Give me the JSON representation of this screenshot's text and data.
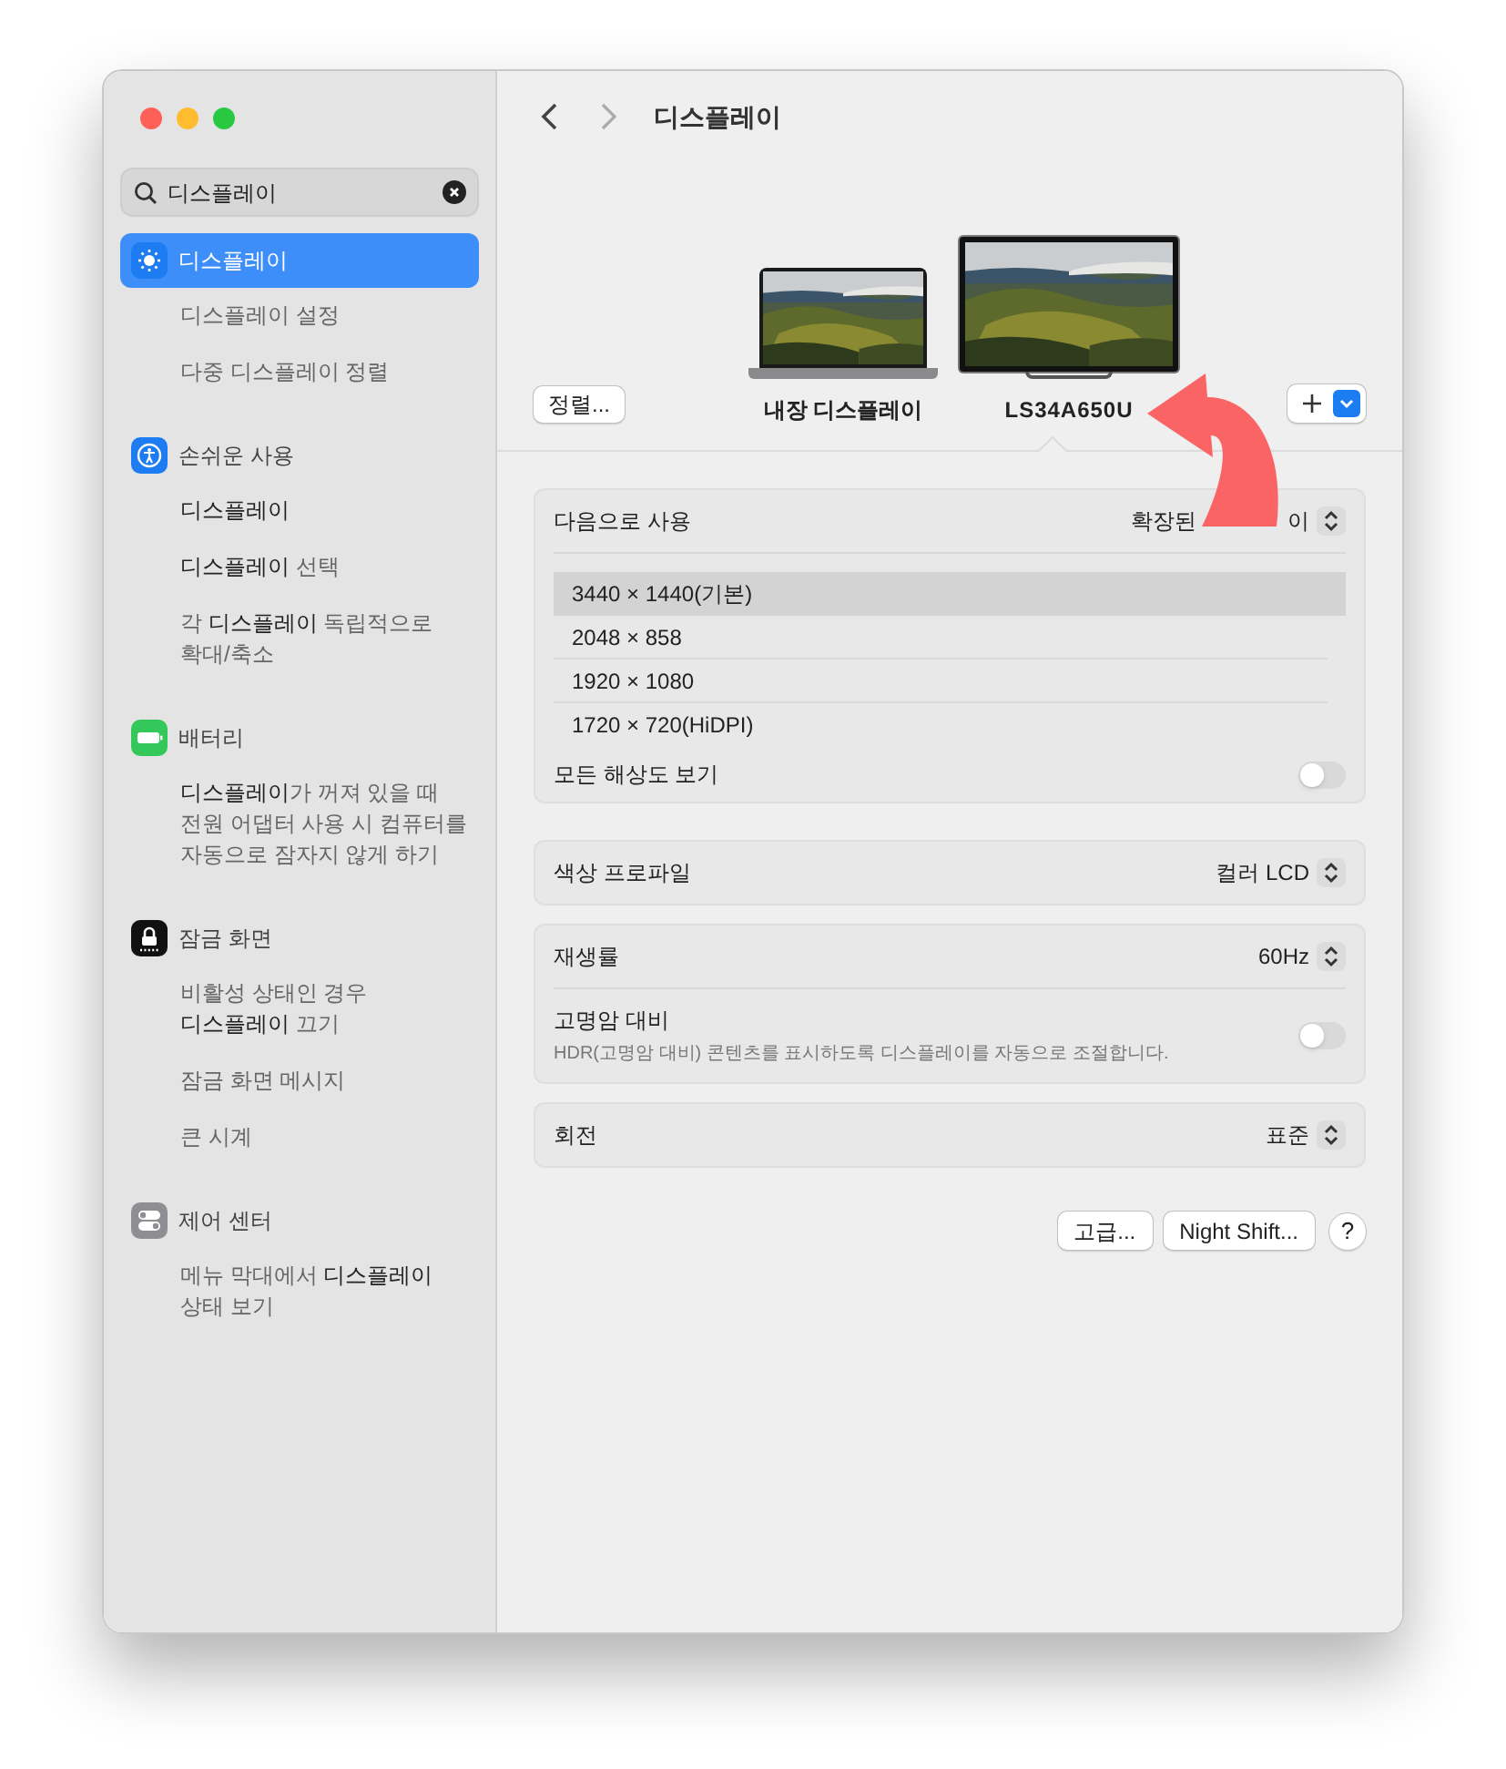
{
  "window": {
    "title": "디스플레이"
  },
  "search": {
    "value": "디스플레이"
  },
  "sidebar": {
    "groups": [
      {
        "kind": "display",
        "title": "디스플레이",
        "selected": true,
        "items": [
          "디스플레이 설정",
          "다중 디스플레이 정렬"
        ]
      },
      {
        "kind": "accessibility",
        "title": "손쉬운 사용",
        "selected": false,
        "items": [
          "**디스플레이**",
          "**디스플레이** 선택",
          "각 **디스플레이** 독립적으로\n확대/축소"
        ]
      },
      {
        "kind": "battery",
        "title": "배터리",
        "selected": false,
        "items": [
          "**디스플레이**가 꺼져 있을 때\n전원 어댑터 사용 시 컴퓨터를\n자동으로 잠자지 않게 하기"
        ]
      },
      {
        "kind": "lock",
        "title": "잠금 화면",
        "selected": false,
        "items": [
          "비활성 상태인 경우\n**디스플레이** 끄기",
          "잠금 화면 메시지",
          "큰 시계"
        ]
      },
      {
        "kind": "control",
        "title": "제어 센터",
        "selected": false,
        "items": [
          "메뉴 막대에서 **디스플레이**\n상태 보기"
        ]
      }
    ]
  },
  "arrange_button": "정렬...",
  "displays": [
    {
      "kind": "laptop",
      "name": "내장 디스플레이",
      "selected": false
    },
    {
      "kind": "monitor",
      "name": "LS34A650U",
      "selected": true
    }
  ],
  "use_as": {
    "label": "다음으로 사용",
    "visible_parts": [
      "확장된",
      "이"
    ]
  },
  "resolutions": [
    {
      "label": "3440 × 1440(기본)",
      "selected": true
    },
    {
      "label": "2048 × 858",
      "selected": false
    },
    {
      "label": "1920 × 1080",
      "selected": false
    },
    {
      "label": "1720 × 720(HiDPI)",
      "selected": false
    }
  ],
  "show_all": {
    "label": "모든 해상도 보기",
    "on": false
  },
  "color_profile": {
    "label": "색상 프로파일",
    "value": "컬러 LCD"
  },
  "refresh_rate": {
    "label": "재생률",
    "value": "60Hz"
  },
  "hdr": {
    "label": "고명암 대비",
    "description": "HDR(고명암 대비) 콘텐츠를 표시하도록 디스플레이를 자동으로 조절합니다.",
    "on": false
  },
  "rotation": {
    "label": "회전",
    "value": "표준"
  },
  "buttons": [
    "고급...",
    "Night Shift..."
  ],
  "help": "?"
}
